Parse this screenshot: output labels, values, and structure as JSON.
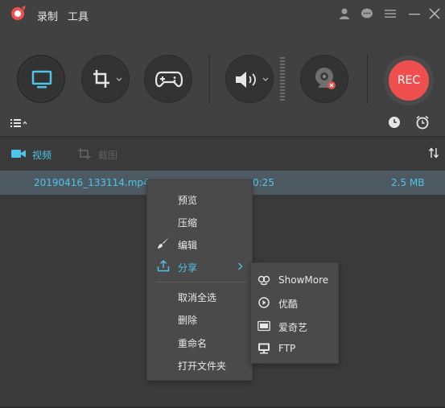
{
  "titlebar": {
    "menu": [
      "录制",
      "工具"
    ]
  },
  "toolbar": {
    "rec_label": "REC"
  },
  "tabs": {
    "video_label": "视频",
    "screenshot_label": "截图"
  },
  "file_row": {
    "name": "20190416_133114.mp4",
    "duration": "0:25",
    "size": "2.5 MB"
  },
  "context_menu": {
    "items": [
      "预览",
      "压缩",
      "编辑",
      "分享",
      "取消全选",
      "删除",
      "重命名",
      "打开文件夹"
    ]
  },
  "share_submenu": {
    "items": [
      "ShowMore",
      "优酷",
      "爱奇艺",
      "FTP"
    ]
  },
  "colors": {
    "accent": "#4fc3e8",
    "rec": "#f04f4f",
    "background": "#3a3a3a"
  }
}
